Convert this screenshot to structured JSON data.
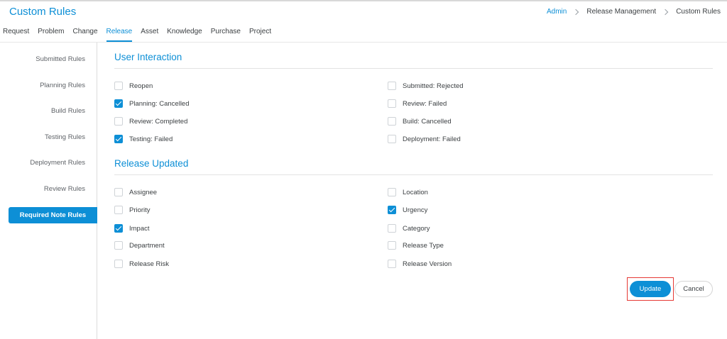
{
  "page_title": "Custom Rules",
  "breadcrumb": [
    "Admin",
    "Release Management",
    "Custom Rules"
  ],
  "tabs": [
    {
      "label": "Request",
      "active": false
    },
    {
      "label": "Problem",
      "active": false
    },
    {
      "label": "Change",
      "active": false
    },
    {
      "label": "Release",
      "active": true
    },
    {
      "label": "Asset",
      "active": false
    },
    {
      "label": "Knowledge",
      "active": false
    },
    {
      "label": "Purchase",
      "active": false
    },
    {
      "label": "Project",
      "active": false
    }
  ],
  "sidebar": {
    "items": [
      {
        "label": "Submitted Rules",
        "active": false
      },
      {
        "label": "Planning Rules",
        "active": false
      },
      {
        "label": "Build Rules",
        "active": false
      },
      {
        "label": "Testing Rules",
        "active": false
      },
      {
        "label": "Deployment Rules",
        "active": false
      },
      {
        "label": "Review Rules",
        "active": false
      },
      {
        "label": "Required Note Rules",
        "active": true
      }
    ]
  },
  "sections": [
    {
      "title": "User Interaction",
      "left": [
        {
          "label": "Reopen",
          "checked": false
        },
        {
          "label": "Planning: Cancelled",
          "checked": true
        },
        {
          "label": "Review: Completed",
          "checked": false
        },
        {
          "label": "Testing: Failed",
          "checked": true
        }
      ],
      "right": [
        {
          "label": "Submitted: Rejected",
          "checked": false
        },
        {
          "label": "Review: Failed",
          "checked": false
        },
        {
          "label": "Build: Cancelled",
          "checked": false
        },
        {
          "label": "Deployment: Failed",
          "checked": false
        }
      ]
    },
    {
      "title": "Release Updated",
      "left": [
        {
          "label": "Assignee",
          "checked": false
        },
        {
          "label": "Priority",
          "checked": false
        },
        {
          "label": "Impact",
          "checked": true
        },
        {
          "label": "Department",
          "checked": false
        },
        {
          "label": "Release Risk",
          "checked": false
        }
      ],
      "right": [
        {
          "label": "Location",
          "checked": false
        },
        {
          "label": "Urgency",
          "checked": true
        },
        {
          "label": "Category",
          "checked": false
        },
        {
          "label": "Release Type",
          "checked": false
        },
        {
          "label": "Release Version",
          "checked": false
        }
      ]
    }
  ],
  "actions": {
    "update_label": "Update",
    "cancel_label": "Cancel"
  },
  "colors": {
    "accent": "#0d8fd6",
    "highlight": "#e53935"
  }
}
